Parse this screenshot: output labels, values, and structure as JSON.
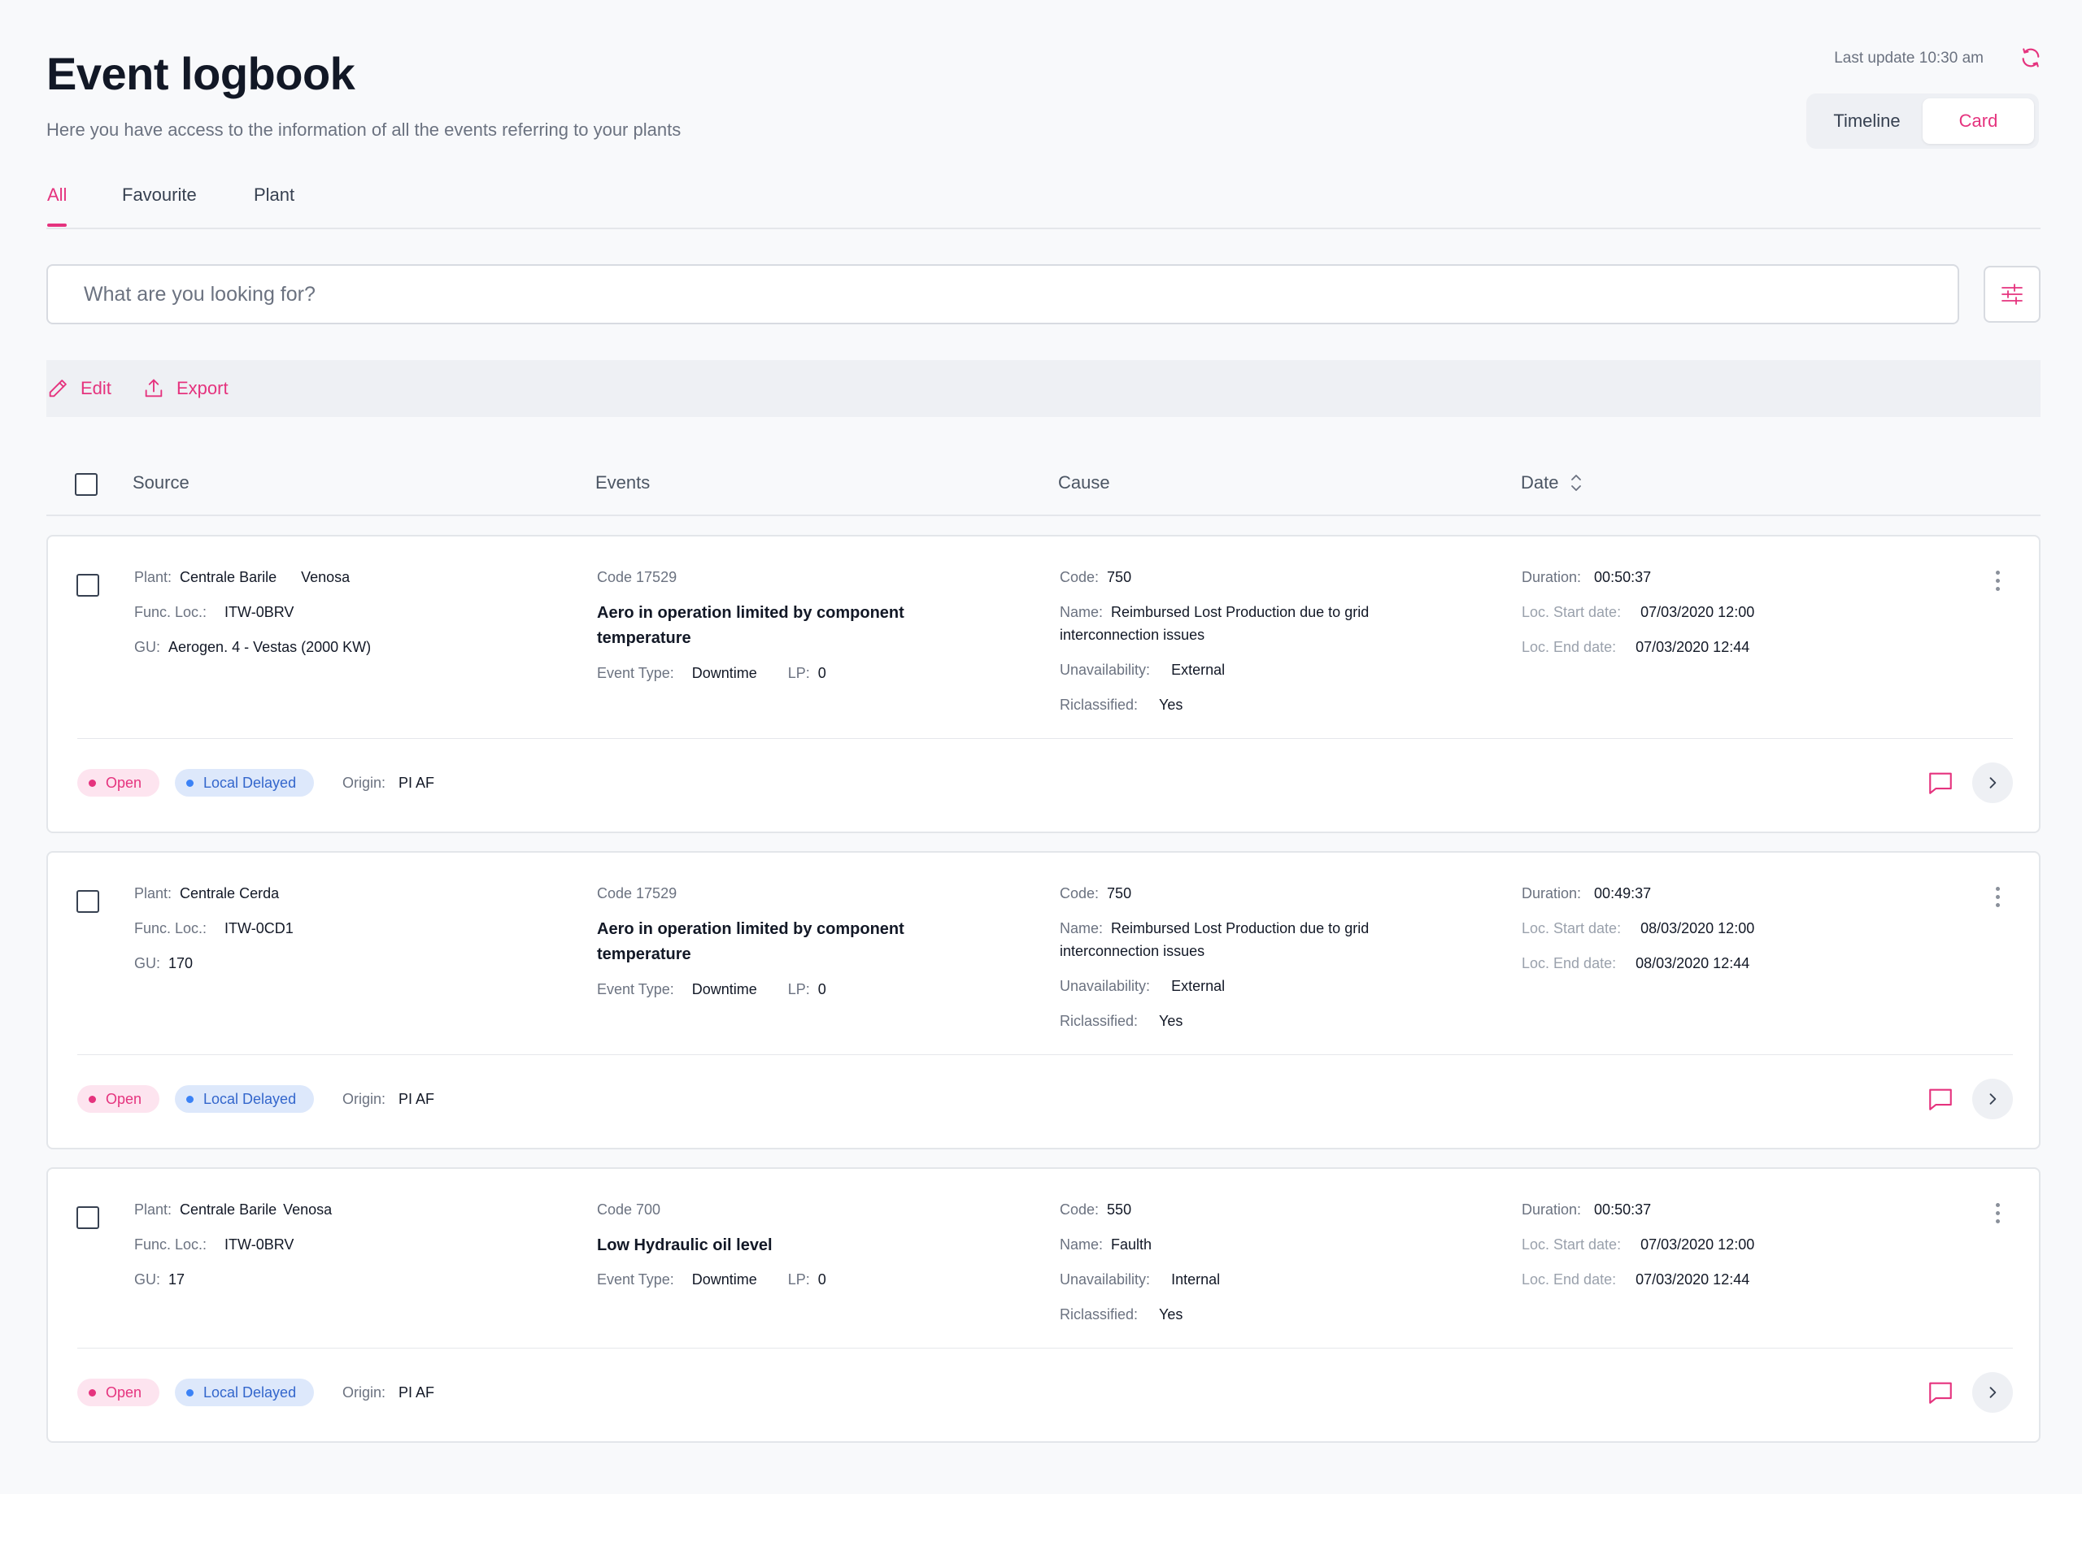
{
  "header": {
    "title": "Event logbook",
    "subtitle": "Here you have access to the information of all the events referring to your plants",
    "last_update": "Last update 10:30 am"
  },
  "view_toggle": {
    "options": [
      "Timeline",
      "Card"
    ],
    "selected": "Card"
  },
  "tabs": [
    {
      "label": "All",
      "active": true
    },
    {
      "label": "Favourite",
      "active": false
    },
    {
      "label": "Plant",
      "active": false
    }
  ],
  "search": {
    "placeholder": "What are you looking for?",
    "value": ""
  },
  "actions": {
    "edit_label": "Edit",
    "export_label": "Export"
  },
  "columns": {
    "source": "Source",
    "events": "Events",
    "cause": "Cause",
    "date": "Date"
  },
  "labels": {
    "plant": "Plant:",
    "func_loc": "Func. Loc.:",
    "gu": "GU:",
    "event_type": "Event Type:",
    "lp": "LP:",
    "code": "Code:",
    "name": "Name:",
    "unavailability": "Unavailability:",
    "riclassified": "Riclassified:",
    "duration": "Duration:",
    "loc_start": "Loc. Start date:",
    "loc_end": "Loc. End date:",
    "origin": "Origin:"
  },
  "colors": {
    "accent": "#e5337e",
    "info": "#3366cc",
    "background": "#f8f9fb"
  },
  "icons": [
    "refresh-icon",
    "filter-sliders-icon",
    "pencil-icon",
    "upload-icon",
    "sort-icon",
    "kebab-menu-icon",
    "comment-icon",
    "chevron-right-icon"
  ],
  "events": [
    {
      "plant": "Centrale Barile",
      "plant_extra": "Venosa",
      "func_loc": "ITW-0BRV",
      "gu": "Aerogen. 4 - Vestas (2000 KW)",
      "event_code": "Code 17529",
      "event_title": "Aero in operation limited by component temperature",
      "event_type": "Downtime",
      "lp": "0",
      "cause_code": "750",
      "cause_name": "Reimbursed Lost Production due to grid interconnection issues",
      "unavailability": "External",
      "riclassified": "Yes",
      "duration": "00:50:37",
      "loc_start": "07/03/2020 12:00",
      "loc_end": "07/03/2020 12:44",
      "status": "Open",
      "delay": "Local Delayed",
      "origin": "PI AF"
    },
    {
      "plant": "Centrale Cerda",
      "plant_extra": "",
      "func_loc": "ITW-0CD1",
      "gu": "170",
      "event_code": "Code 17529",
      "event_title": "Aero in operation limited by component temperature",
      "event_type": "Downtime",
      "lp": "0",
      "cause_code": "750",
      "cause_name": "Reimbursed Lost Production due to grid interconnection issues",
      "unavailability": "External",
      "riclassified": "Yes",
      "duration": "00:49:37",
      "loc_start": "08/03/2020 12:00",
      "loc_end": "08/03/2020 12:44",
      "status": "Open",
      "delay": "Local Delayed",
      "origin": "PI AF"
    },
    {
      "plant": "Centrale Barile",
      "plant_extra": "Venosa",
      "func_loc": "ITW-0BRV",
      "gu": "17",
      "event_code": "Code 700",
      "event_title": "Low Hydraulic oil level",
      "event_type": "Downtime",
      "lp": "0",
      "cause_code": "550",
      "cause_name": "Faulth",
      "unavailability": "Internal",
      "riclassified": "Yes",
      "duration": "00:50:37",
      "loc_start": "07/03/2020 12:00",
      "loc_end": "07/03/2020 12:44",
      "status": "Open",
      "delay": "Local Delayed",
      "origin": "PI AF"
    }
  ]
}
